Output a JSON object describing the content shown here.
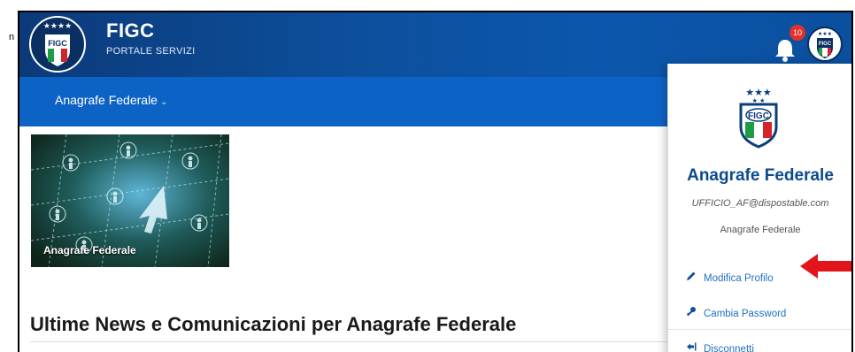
{
  "header": {
    "brand_title": "FIGC",
    "brand_subtitle": "PORTALE SERVIZI",
    "notification_count": "10",
    "logo_text": "FIGC"
  },
  "nav": {
    "items": [
      {
        "label": "Anagrafe Federale"
      }
    ]
  },
  "tile": {
    "label": "Anagrafe Federale"
  },
  "news": {
    "heading": "Ultime News e Comunicazioni per Anagrafe Federale"
  },
  "profile_menu": {
    "logo_text": "FIGC",
    "title": "Anagrafe Federale",
    "email": "UFFICIO_AF@dispostable.com",
    "role": "Anagrafe Federale",
    "links": [
      {
        "label": "Modifica Profilo",
        "icon": "pencil-icon"
      },
      {
        "label": "Cambia Password",
        "icon": "key-icon"
      },
      {
        "label": "Disconnetti",
        "icon": "sign-out-icon"
      }
    ]
  },
  "colors": {
    "header_blue": "#0b4f9e",
    "nav_blue": "#0d63c5",
    "title_blue": "#0c4a8c",
    "link_blue": "#1f6fc4",
    "badge_red": "#e2302a",
    "arrow_red": "#e3151a"
  }
}
